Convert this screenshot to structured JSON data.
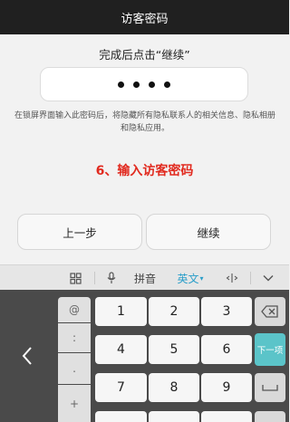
{
  "header": {
    "title": "访客密码"
  },
  "main": {
    "instruction": "完成后点击“继续”",
    "pin_dots": 4,
    "description": "在锁屏界面输入此密码后，将隐藏所有隐私联系人的相关信息、隐私相册和隐私应用。",
    "step_label": "6、输入访客密码",
    "prev_button": "上一步",
    "next_button": "继续"
  },
  "ime_toolbar": {
    "pinyin": "拼音",
    "english": "英文",
    "icons": [
      "grid-icon",
      "mic-icon",
      "cursor-move-icon",
      "chevron-down-icon"
    ]
  },
  "keyboard": {
    "symbols": [
      "@",
      ":",
      ".",
      "+"
    ],
    "digits": [
      "1",
      "2",
      "3",
      "4",
      "5",
      "6",
      "7",
      "8",
      "9"
    ],
    "next_field": "下一项",
    "colors": {
      "accent": "#5bc4c9",
      "keyboard_bg": "#4a4a4a"
    }
  },
  "colors": {
    "step_red": "#e12a1f",
    "titlebar_bg": "#202020"
  }
}
